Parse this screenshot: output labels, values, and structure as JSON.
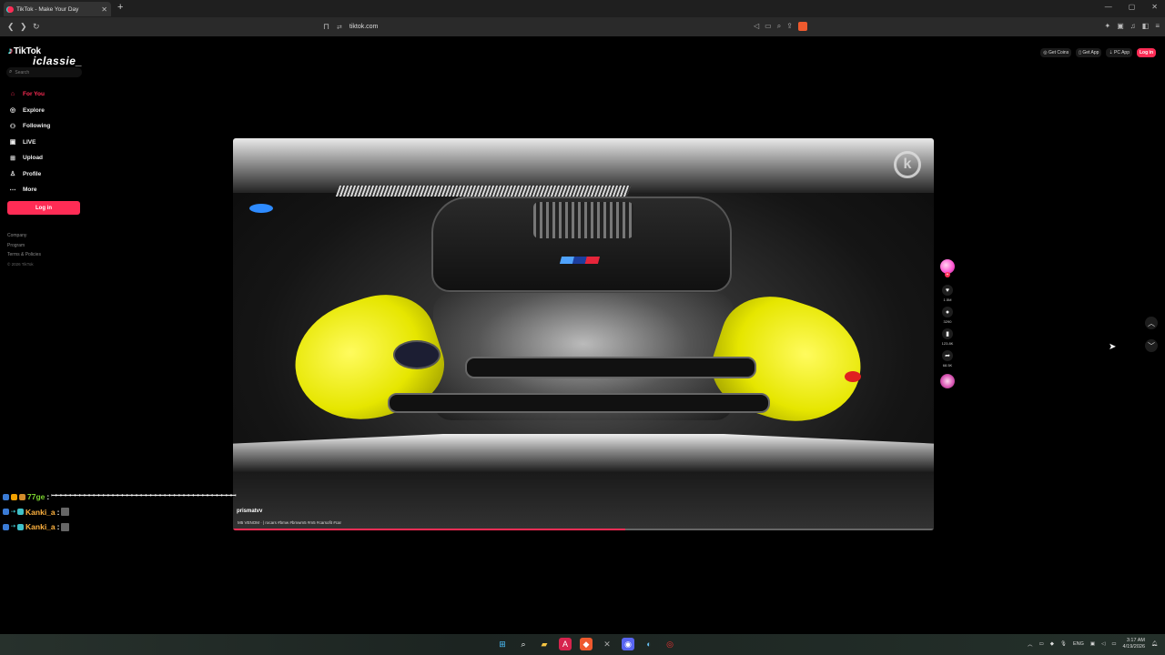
{
  "browser": {
    "tab_title": "TikTok - Make Your Day",
    "url": "tiktok.com",
    "new_tab": "+",
    "close": "✕"
  },
  "logo": {
    "text": "TikTok",
    "overlay": "iclassie_"
  },
  "search": {
    "placeholder": "Search"
  },
  "sidebar": {
    "items": [
      {
        "label": "For You",
        "icon": "home-icon"
      },
      {
        "label": "Explore",
        "icon": "compass-icon"
      },
      {
        "label": "Following",
        "icon": "following-icon"
      },
      {
        "label": "LIVE",
        "icon": "live-icon"
      },
      {
        "label": "Upload",
        "icon": "upload-icon"
      },
      {
        "label": "Profile",
        "icon": "profile-icon"
      },
      {
        "label": "More",
        "icon": "more-icon"
      }
    ],
    "login": "Log in",
    "footer": [
      "Company",
      "Program",
      "Terms & Policies"
    ],
    "copyright": "© 2026 TikTok"
  },
  "top_actions": {
    "get_coins": "Get Coins",
    "get_app": "Get App",
    "pc_app": "PC App",
    "login": "Log in"
  },
  "video": {
    "author": "prismatvv",
    "caption": "M5 VENOM  ·  |  rocars #bmw #bmwm5 #m5 #carsofit #car",
    "progress": 0.56
  },
  "rail": {
    "likes": "1.5M",
    "comments": "3290",
    "saves": "123.8K",
    "shares": "68.5K"
  },
  "chat": [
    {
      "user": "77ge",
      "message": "ꟷꟷꟷꟷꟷꟷꟷꟷꟷꟷꟷꟷꟷꟷꟷꟷꟷꟷꟷꟷꟷꟷꟷꟷꟷꟷꟷꟷꟷꟷꟷꟷꟷꟷꟷꟷꟷꟷꟷ"
    },
    {
      "user": "Kanki_a",
      "message": ""
    },
    {
      "user": "Kanki_a",
      "message": ""
    }
  ],
  "taskbar": {
    "lang": "ENG",
    "time": "3:17 AM",
    "date": "4/19/2026"
  }
}
